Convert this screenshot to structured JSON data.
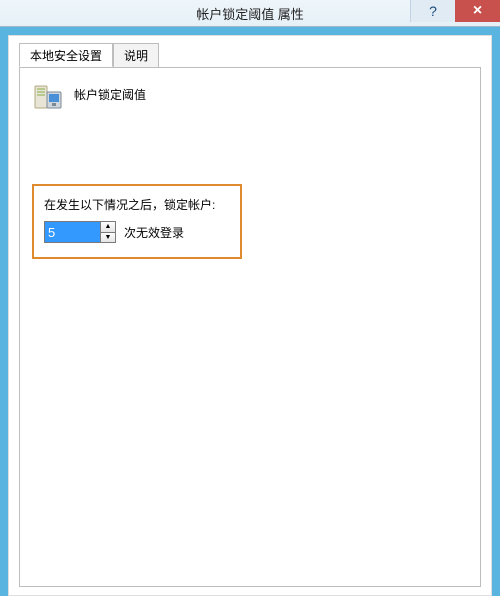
{
  "window": {
    "title": "帐户锁定阈值 属性",
    "help_symbol": "?",
    "close_symbol": "×"
  },
  "tabs": {
    "local": "本地安全设置",
    "explain": "说明"
  },
  "page": {
    "heading": "帐户锁定阈值",
    "prompt": "在发生以下情况之后，锁定帐户:",
    "value": "5",
    "suffix": "次无效登录",
    "spin_up": "▲",
    "spin_down": "▼"
  }
}
